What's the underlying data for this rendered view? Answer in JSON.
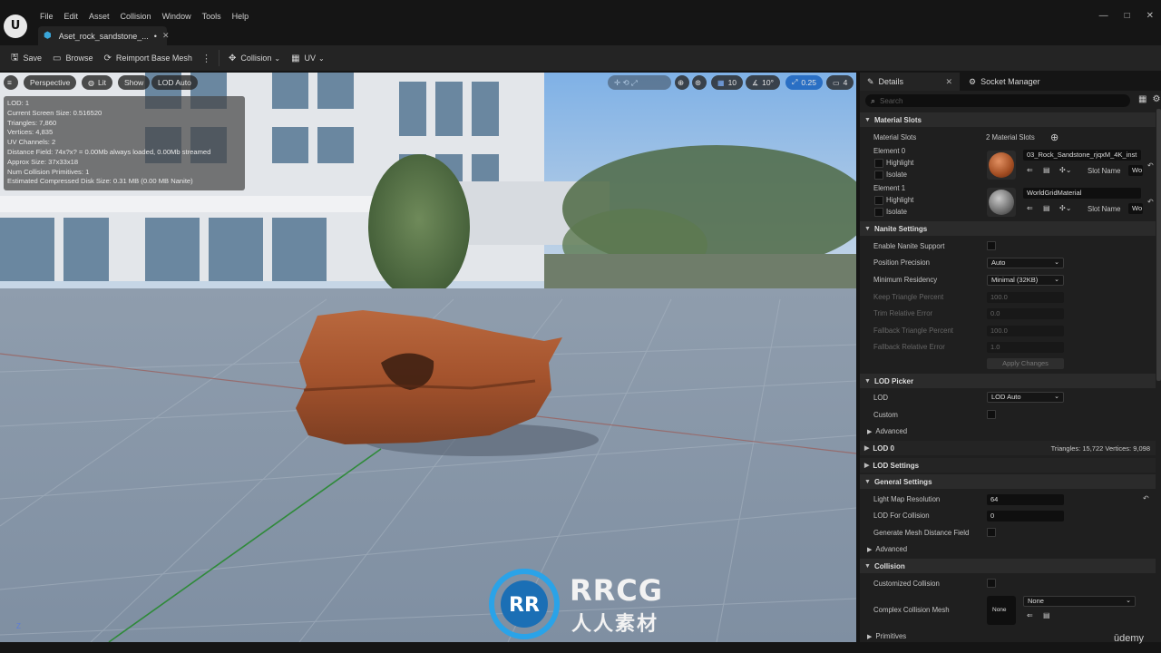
{
  "app": {
    "logo": "U",
    "menu": [
      "File",
      "Edit",
      "Asset",
      "Collision",
      "Window",
      "Tools",
      "Help"
    ],
    "document_tab": "Aset_rock_sandstone_...",
    "window_controls": [
      "—",
      "□",
      "✕"
    ]
  },
  "toolbar": {
    "save": "Save",
    "browse": "Browse",
    "reimport": "Reimport Base Mesh",
    "collision": "Collision",
    "uv": "UV"
  },
  "viewport": {
    "perspective": "Perspective",
    "lit": "Lit",
    "show": "Show",
    "lod": "LOD Auto",
    "grid_snap": "10",
    "rot_snap": "10°",
    "scale_snap": "0.25",
    "cam_speed": "4",
    "stats": [
      "LOD:  1",
      "Current Screen Size:  0.516520",
      "Triangles:  7,860",
      "Vertices:  4,835",
      "UV Channels:  2",
      "Distance Field: 74x?x? = 0.00Mb always loaded, 0.00Mb streamed",
      "Approx Size: 37x33x18",
      "Num Collision Primitives:  1",
      "Estimated Compressed Disk Size: 0.31 MB (0.00 MB Nanite)"
    ],
    "axis_label": "Z"
  },
  "watermark": {
    "line1": "RRCG",
    "line2": "人人素材"
  },
  "details": {
    "tab_details": "Details",
    "tab_socket": "Socket Manager",
    "search_placeholder": "Search",
    "material_slots": {
      "header": "Material Slots",
      "label": "Material Slots",
      "count": "2 Material Slots",
      "element0": "Element 0",
      "element1": "Element 1",
      "highlight": "Highlight",
      "isolate": "Isolate",
      "mat0": "03_Rock_Sandstone_rjqxM_4K_inst",
      "mat1": "WorldGridMaterial",
      "slot_name": "Slot Name",
      "slot_val": "Wo"
    },
    "nanite": {
      "header": "Nanite Settings",
      "enable": "Enable Nanite Support",
      "position_precision": "Position Precision",
      "position_precision_val": "Auto",
      "min_residency": "Minimum Residency",
      "min_residency_val": "Minimal (32KB)",
      "keep_tri": "Keep Triangle Percent",
      "keep_tri_val": "100.0",
      "trim_err": "Trim Relative Error",
      "trim_err_val": "0.0",
      "fallback_tri": "Fallback Triangle Percent",
      "fallback_tri_val": "100.0",
      "fallback_err": "Fallback Relative Error",
      "fallback_err_val": "1.0",
      "apply": "Apply Changes"
    },
    "lod_picker": {
      "header": "LOD Picker",
      "lod": "LOD",
      "lod_val": "LOD Auto",
      "custom": "Custom",
      "advanced": "Advanced"
    },
    "lod0": {
      "header": "LOD 0",
      "stats": "Triangles: 15,722   Vertices: 9,098"
    },
    "lod_settings": {
      "header": "LOD Settings"
    },
    "general": {
      "header": "General Settings",
      "lightmap": "Light Map Resolution",
      "lightmap_val": "64",
      "lod_collision": "LOD For Collision",
      "lod_collision_val": "0",
      "gen_df": "Generate Mesh Distance Field",
      "advanced": "Advanced"
    },
    "collision": {
      "header": "Collision",
      "customized": "Customized Collision",
      "complex_mesh": "Complex Collision Mesh",
      "complex_val": "None",
      "thumb_label": "None",
      "primitives": "Primitives"
    }
  },
  "brand": "ūdemy"
}
